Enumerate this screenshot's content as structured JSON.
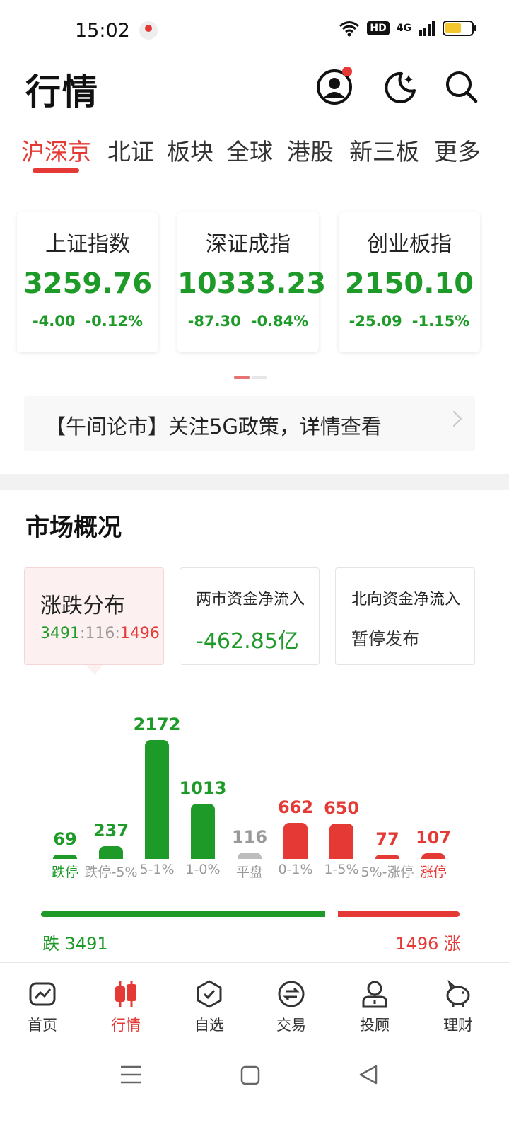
{
  "status_bar": {
    "time": "15:02",
    "hd": "HD",
    "network": "4G"
  },
  "header": {
    "title": "行情"
  },
  "tabs": [
    {
      "label": "沪深京",
      "active": true
    },
    {
      "label": "北证"
    },
    {
      "label": "板块"
    },
    {
      "label": "全球"
    },
    {
      "label": "港股"
    },
    {
      "label": "新三板"
    },
    {
      "label": "更多"
    }
  ],
  "indices": [
    {
      "name": "上证指数",
      "value": "3259.76",
      "change": "-4.00",
      "pct": "-0.12%"
    },
    {
      "name": "深证成指",
      "value": "10333.23",
      "change": "-87.30",
      "pct": "-0.84%"
    },
    {
      "name": "创业板指",
      "value": "2150.10",
      "change": "-25.09",
      "pct": "-1.15%"
    }
  ],
  "news": {
    "text": "【午间论市】关注5G政策，详情查看"
  },
  "market_overview": {
    "title": "市场概况",
    "cards": [
      {
        "title": "涨跌分布",
        "down": "3491",
        "sep": ":",
        "flat": "116",
        "up": "1496"
      },
      {
        "title": "两市资金净流入",
        "value": "-462.85亿"
      },
      {
        "title": "北向资金净流入",
        "value": "暂停发布"
      }
    ]
  },
  "chart_data": {
    "type": "bar",
    "categories": [
      "跌停",
      "跌停-5%",
      "5-1%",
      "1-0%",
      "平盘",
      "0-1%",
      "1-5%",
      "5%-涨停",
      "涨停"
    ],
    "values": [
      69,
      237,
      2172,
      1013,
      116,
      662,
      650,
      77,
      107
    ],
    "colors": [
      "#1e9a29",
      "#1e9a29",
      "#1e9a29",
      "#1e9a29",
      "#bdbdbd",
      "#e53935",
      "#e53935",
      "#e53935",
      "#e53935"
    ],
    "label_colors": [
      "green",
      "gray",
      "gray",
      "gray",
      "gray",
      "gray",
      "gray",
      "gray",
      "red"
    ],
    "value_colors": [
      "green",
      "green",
      "green",
      "green",
      "gray",
      "red",
      "red",
      "red",
      "red"
    ]
  },
  "rise_fall": {
    "down_label": "跌 3491",
    "up_label": "1496 涨",
    "down": 3491,
    "up": 1496,
    "colors": {
      "down": "#1e9a29",
      "up": "#e53935"
    }
  },
  "bottom_nav": [
    {
      "label": "首页",
      "icon": "chart-window-icon"
    },
    {
      "label": "行情",
      "icon": "candlestick-icon",
      "active": true
    },
    {
      "label": "自选",
      "icon": "check-shield-icon"
    },
    {
      "label": "交易",
      "icon": "exchange-icon"
    },
    {
      "label": "投顾",
      "icon": "advisor-icon"
    },
    {
      "label": "理财",
      "icon": "piggy-bank-icon"
    }
  ]
}
